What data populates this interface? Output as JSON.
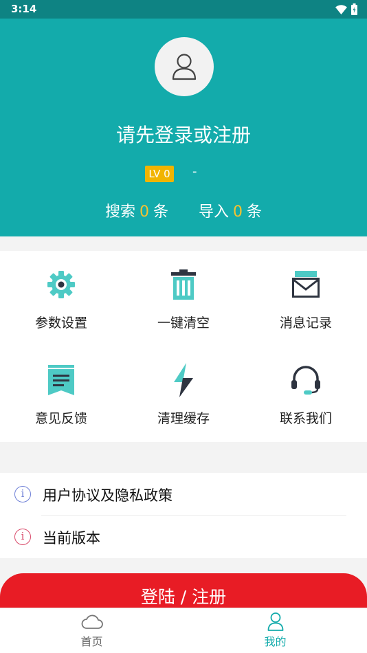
{
  "status_bar": {
    "time": "3:14"
  },
  "profile": {
    "prompt": "请先登录或注册",
    "level_badge": "LV 0",
    "username": "-",
    "search_label": "搜索",
    "search_count": "0",
    "search_unit": "条",
    "import_label": "导入",
    "import_count": "0",
    "import_unit": "条"
  },
  "menu": [
    {
      "label": "参数设置",
      "icon": "gear-icon"
    },
    {
      "label": "一键清空",
      "icon": "trash-icon"
    },
    {
      "label": "消息记录",
      "icon": "mail-icon"
    },
    {
      "label": "意见反馈",
      "icon": "feedback-icon"
    },
    {
      "label": "清理缓存",
      "icon": "lightning-icon"
    },
    {
      "label": "联系我们",
      "icon": "headset-icon"
    }
  ],
  "list": [
    {
      "label": "用户协议及隐私政策",
      "icon": "info-icon"
    },
    {
      "label": "当前版本",
      "icon": "info-icon"
    }
  ],
  "login_button": "登陆 / 注册",
  "tabs": [
    {
      "label": "首页",
      "icon": "cloud-icon"
    },
    {
      "label": "我的",
      "icon": "user-icon"
    }
  ],
  "colors": {
    "header": "#13abab",
    "status_bar": "#0e8383",
    "accent_count": "#f6c230",
    "badge": "#f1b400",
    "login_button": "#e81c25",
    "icon_teal": "#4ecac5",
    "icon_dark": "#2e3440",
    "info_blue": "#6d7fd6",
    "info_red": "#d94a6a"
  }
}
